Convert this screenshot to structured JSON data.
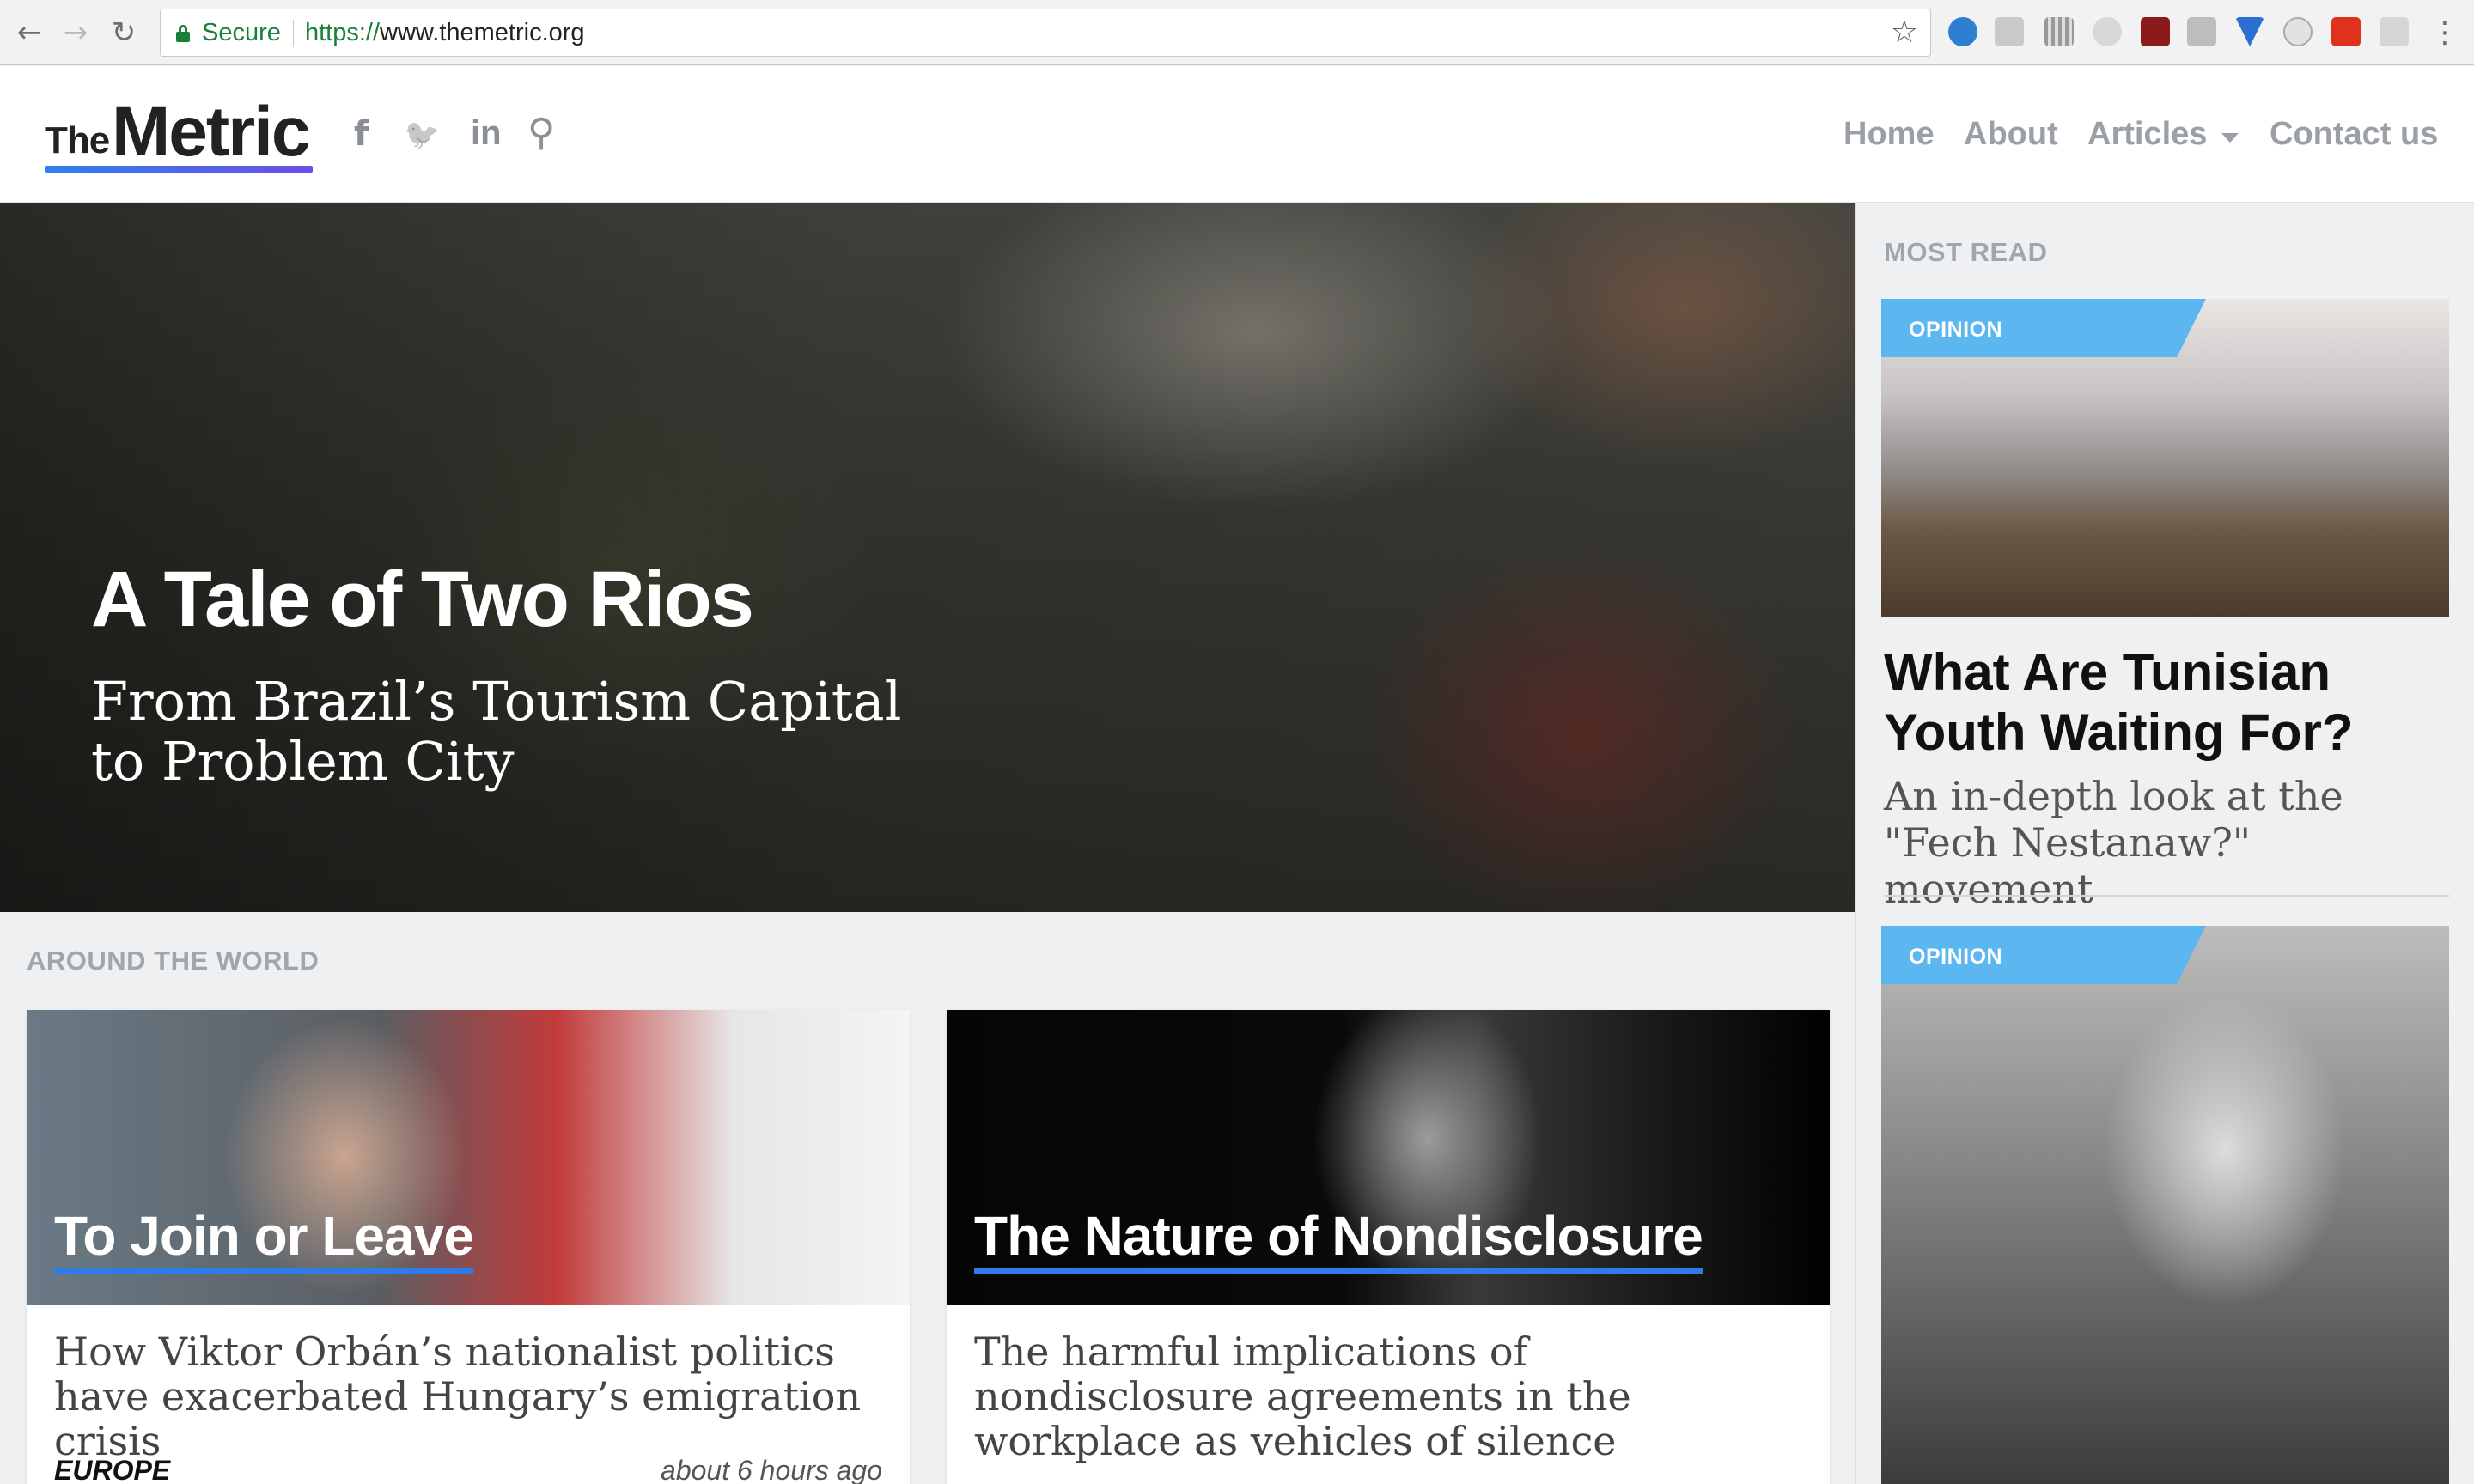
{
  "browser": {
    "back_glyph": "←",
    "forward_glyph": "→",
    "reload_glyph": "↻",
    "secure_label": "Secure",
    "url_scheme": "https://",
    "url_host": "www.themetric.org",
    "star_glyph": "☆"
  },
  "header": {
    "logo_the": "The",
    "logo_metric": "Metric",
    "social": {
      "facebook": "f",
      "twitter": "🐦",
      "linkedin": "in",
      "search": "⚲"
    },
    "nav": {
      "home": "Home",
      "about": "About",
      "articles": "Articles",
      "contact": "Contact us"
    }
  },
  "hero": {
    "title": "A Tale of Two Rios",
    "subtitle": "From Brazil’s Tourism Capital to Problem City"
  },
  "sidebar": {
    "section_label": "MOST READ",
    "items": [
      {
        "badge": "OPINION",
        "title": "What Are Tunisian Youth Waiting For?",
        "description": "An in-depth look at the \"Fech Nestanaw?\" movement"
      },
      {
        "badge": "OPINION"
      }
    ]
  },
  "around_the_world": {
    "label": "AROUND THE WORLD",
    "cards": [
      {
        "title": "To Join or Leave",
        "description": "How Viktor Orbán’s nationalist politics have exacerbated Hungary’s emigration crisis",
        "category": "EUROPE",
        "time": "about 6 hours ago"
      },
      {
        "title": "The Nature of Nondisclosure",
        "description": "The harmful implications of nondisclosure agreements in the workplace as vehicles of silence"
      }
    ]
  },
  "colors": {
    "accent": "#2f7be8",
    "badge": "#5cb6f0",
    "nav_text": "#9aa0a6",
    "secure_green": "#188038"
  }
}
